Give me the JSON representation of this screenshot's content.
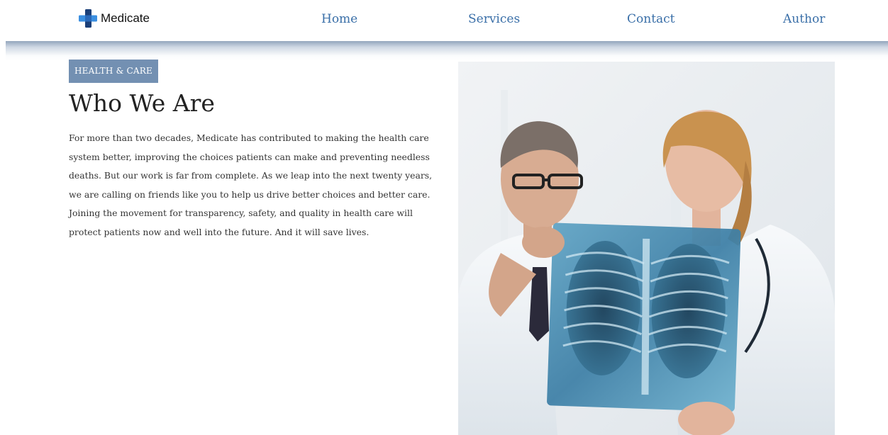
{
  "header": {
    "brand": "Medicate",
    "nav": [
      "Home",
      "Services",
      "Contact",
      "Author"
    ]
  },
  "content": {
    "badge": "HEALTH & CARE",
    "title": "Who We Are",
    "body": "For more than two decades, Medicate has contributed to making the health care system better, improving the choices patients can make and preventing needless deaths. But our work is far from complete. As we leap into the next twenty years, we are calling on friends like you to help us drive better choices and better care. Joining the movement for transparency, safety, and quality in health care will protect patients now and well into the future. And it will save lives."
  },
  "colors": {
    "nav_link": "#3a6fa8",
    "badge_bg": "#7390b2",
    "logo_dark": "#1b3f78",
    "logo_light": "#3b8fe0"
  }
}
